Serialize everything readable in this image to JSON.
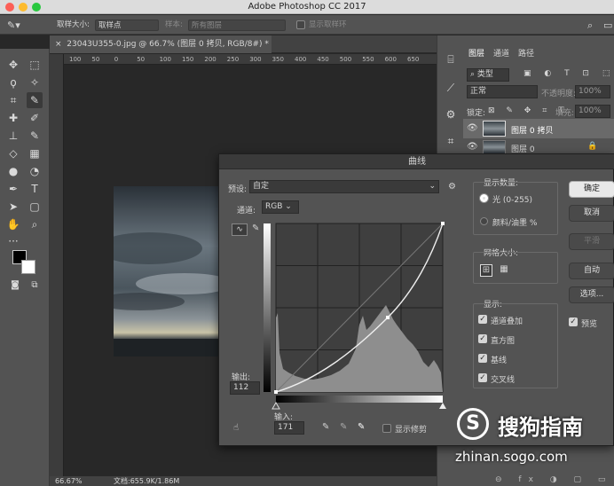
{
  "app_title": "Adobe Photoshop CC 2017",
  "options": {
    "sample_size_label": "取样大小:",
    "sample_size_value": "取样点",
    "sample_label": "样本:",
    "sample_value": "所有图层",
    "show_ring": "显示取样环"
  },
  "document": {
    "tab_title": "23043U355-0.jpg @ 66.7% (图层 0 拷贝, RGB/8#) *",
    "ruler_ticks": [
      "100",
      "50",
      "0",
      "50",
      "100",
      "150",
      "200",
      "250",
      "300",
      "350",
      "400",
      "450",
      "500",
      "550",
      "600",
      "650"
    ]
  },
  "status": {
    "zoom": "66.67%",
    "doc": "文档:655.9K/1.86M"
  },
  "layers_panel": {
    "tabs": [
      "图层",
      "通道",
      "路径"
    ],
    "search": "类型",
    "blend": "正常",
    "opacity_label": "不透明度:",
    "opacity_value": "100%",
    "lock_label": "锁定:",
    "fill_label": "填充:",
    "fill_value": "100%",
    "layers": [
      {
        "name": "图层 0 拷贝"
      },
      {
        "name": "图层 0"
      }
    ]
  },
  "curves": {
    "title": "曲线",
    "preset_label": "预设:",
    "preset_value": "自定",
    "channel_label": "通道:",
    "channel_value": "RGB",
    "output_label": "输出:",
    "output_value": "112",
    "input_label": "输入:",
    "input_value": "171",
    "show_clipping": "显示修剪",
    "display_amount": "显示数量:",
    "light": "光 (0-255)",
    "pigment": "颜料/油墨 %",
    "grid_size": "网格大小:",
    "show": "显示:",
    "opt_channel_overlay": "通道叠加",
    "opt_histogram": "直方图",
    "opt_baseline": "基线",
    "opt_intersection": "交叉线",
    "btn_ok": "确定",
    "btn_cancel": "取消",
    "btn_smooth": "平滑",
    "btn_auto": "自动",
    "btn_options": "选项...",
    "preview": "预览"
  },
  "watermark": {
    "brand": "搜狗指南",
    "url": "zhinan.sogo.com"
  },
  "colors": {
    "accent": "#2d6bd6",
    "panel": "#535353"
  }
}
